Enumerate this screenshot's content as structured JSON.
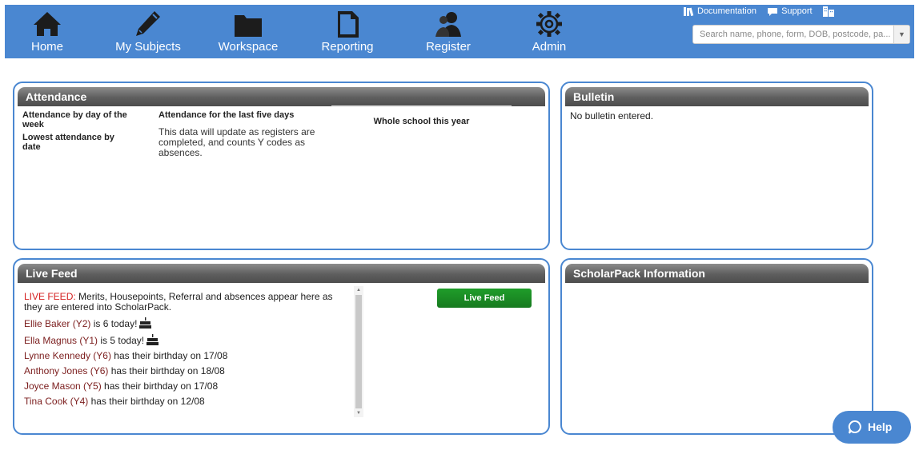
{
  "nav": {
    "items": [
      {
        "label": "Home",
        "icon": "home-icon"
      },
      {
        "label": "My Subjects",
        "icon": "pencil-icon"
      },
      {
        "label": "Workspace",
        "icon": "folder-icon"
      },
      {
        "label": "Reporting",
        "icon": "document-icon"
      },
      {
        "label": "Register",
        "icon": "user-icon"
      },
      {
        "label": "Admin",
        "icon": "gear-icon"
      }
    ],
    "links": {
      "documentation": "Documentation",
      "support": "Support"
    },
    "search_placeholder": "Search name, phone, form, DOB, postcode, pa..."
  },
  "attendance": {
    "title": "Attendance",
    "by_day": "Attendance by day of the week",
    "lowest": "Lowest attendance by date",
    "last_five_title": "Attendance for the last five days",
    "last_five_text": "This data will update as registers are completed, and counts Y codes as absences.",
    "whole_school": "Whole school this year"
  },
  "bulletin": {
    "title": "Bulletin",
    "text": "No bulletin entered."
  },
  "livefeed": {
    "title": "Live Feed",
    "intro_prefix": "LIVE FEED:",
    "intro_text": " Merits, Housepoints, Referral and absences appear here as they are entered into ScholarPack.",
    "button": "Live Feed",
    "entries": [
      {
        "name": "Ellie Baker (Y2)",
        "text": " is 6 today!",
        "cake": true
      },
      {
        "name": "Ella Magnus (Y1)",
        "text": " is 5 today!",
        "cake": true
      },
      {
        "name": "Lynne Kennedy (Y6)",
        "text": " has their birthday on 17/08",
        "cake": false
      },
      {
        "name": "Anthony Jones (Y6)",
        "text": " has their birthday on 18/08",
        "cake": false
      },
      {
        "name": "Joyce Mason (Y5)",
        "text": " has their birthday on 17/08",
        "cake": false
      },
      {
        "name": "Tina Cook (Y4)",
        "text": " has their birthday on 12/08",
        "cake": false
      }
    ]
  },
  "scholarpack": {
    "title": "ScholarPack Information"
  },
  "help": {
    "label": "Help"
  },
  "colors": {
    "brand": "#4a87d1",
    "live_button": "#1f9d2a",
    "live_red": "#d42020",
    "name": "#7b1d1d"
  }
}
